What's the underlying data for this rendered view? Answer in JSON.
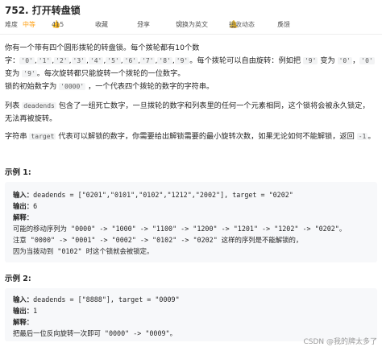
{
  "problem": {
    "title": "752. 打开转盘锁",
    "difficulty_label": "难度",
    "difficulty": "中等",
    "likes": "415",
    "favorite": "收藏",
    "share": "分享",
    "language": "切换为英文",
    "notify": "接收动态",
    "feedback": "反馈"
  },
  "description": {
    "p1_a": "你有一个带有四个圆形拨轮的转盘锁。每个拨轮都有10个数字：",
    "p1_digits": [
      "'0'",
      "'1'",
      "'2'",
      "'3'",
      "'4'",
      "'5'",
      "'6'",
      "'7'",
      "'8'",
      "'9'"
    ],
    "p1_b": "。每个拨轮可以自由旋转：例如把",
    "p1_c": "变为",
    "p1_d": "，",
    "p1_e": "变为",
    "p1_f": "。每次旋转都只能旋转一个拨轮的一位数字。",
    "p2_a": "锁的初始数字为",
    "p2_code": "'0000'",
    "p2_b": "，一个代表四个拨轮的数字的字符串。",
    "p3_a": "列表",
    "p3_code": "deadends",
    "p3_b": "包含了一组死亡数字，一旦拨轮的数字和列表里的任何一个元素相同，这个锁将会被永久锁定，无法再被旋转。",
    "p4_a": "字符串",
    "p4_code": "target",
    "p4_b": "代表可以解锁的数字，你需要给出解锁需要的最小旋转次数，如果无论如何不能解锁，返回",
    "p4_code2": "-1",
    "p4_c": "。"
  },
  "examples": [
    {
      "header": "示例 1:",
      "input_label": "输入：",
      "input": "deadends = [\"0201\",\"0101\",\"0102\",\"1212\",\"2002\"], target = \"0202\"",
      "output_label": "输出：",
      "output": "6",
      "explain_label": "解释：",
      "explain": [
        "可能的移动序列为 \"0000\" -> \"1000\" -> \"1100\" -> \"1200\" -> \"1201\" -> \"1202\" -> \"0202\"。",
        "注意 \"0000\" -> \"0001\" -> \"0002\" -> \"0102\" -> \"0202\" 这样的序列是不能解锁的，",
        "因为当拨动到 \"0102\" 时这个锁就会被锁定。"
      ]
    },
    {
      "header": "示例 2:",
      "input_label": "输入：",
      "input": "deadends = [\"8888\"], target = \"0009\"",
      "output_label": "输出：",
      "output": "1",
      "explain_label": "解释：",
      "explain": [
        "把最后一位反向旋转一次即可 \"0000\" -> \"0009\"。"
      ]
    }
  ],
  "watermark": "CSDN @我的牌太多了",
  "colors": {
    "difficulty": "#ffa116",
    "code_bg": "#f2f3f4",
    "example_bg": "#f7f8fa"
  }
}
